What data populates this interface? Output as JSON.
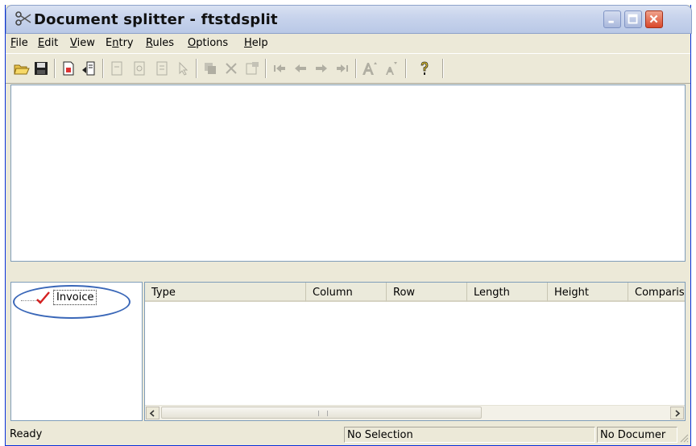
{
  "window": {
    "title": "Document splitter - ftstdsplit",
    "app_icon": "scissors-icon",
    "controls": [
      "minimize-icon",
      "maximize-icon",
      "close-icon"
    ]
  },
  "menu": [
    {
      "label": "File",
      "underline": "F",
      "rest": "ile"
    },
    {
      "label": "Edit",
      "underline": "E",
      "rest": "dit"
    },
    {
      "label": "View",
      "underline": "V",
      "rest": "iew"
    },
    {
      "label": "Entry",
      "pre": "E",
      "underline": "n",
      "rest": "try"
    },
    {
      "label": "Rules",
      "underline": "R",
      "rest": "ules"
    },
    {
      "label": "Options",
      "underline": "O",
      "rest": "ptions"
    },
    {
      "label": "Help",
      "underline": "H",
      "rest": "elp"
    }
  ],
  "toolbar": {
    "icons": [
      "open-folder-icon",
      "save-icon",
      "new-document-icon",
      "import-document-icon",
      "page-icon",
      "page-view-icon",
      "page-text-icon",
      "pointer-icon",
      "copy-icon",
      "delete-icon",
      "properties-icon",
      "first-icon",
      "previous-icon",
      "next-icon",
      "last-icon",
      "font-larger-icon",
      "font-smaller-icon",
      "help-icon"
    ]
  },
  "tree": {
    "items": [
      {
        "label": "Invoice",
        "checked": true,
        "icon": "checkmark-icon"
      }
    ]
  },
  "list": {
    "columns": [
      "Type",
      "Column",
      "Row",
      "Length",
      "Height",
      "Comparis"
    ],
    "rows": []
  },
  "status": {
    "left": "Ready",
    "middle": "No Selection",
    "right": "No Documer"
  },
  "colors": {
    "accent_ring": "#3a67b8",
    "check": "#d42020",
    "close_button": "#d9482b"
  }
}
